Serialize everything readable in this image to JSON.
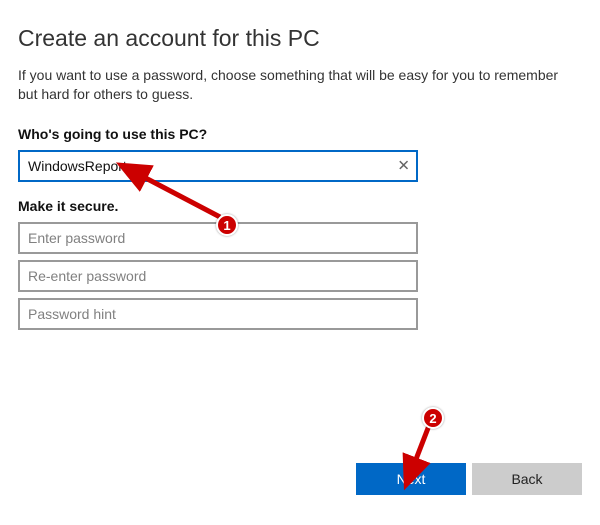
{
  "title": "Create an account for this PC",
  "subtitle": "If you want to use a password, choose something that will be easy for you to remember but hard for others to guess.",
  "username_section": {
    "label": "Who's going to use this PC?",
    "value": "WindowsReport",
    "clear_icon": "✕"
  },
  "password_section": {
    "label": "Make it secure.",
    "password_placeholder": "Enter password",
    "confirm_placeholder": "Re-enter password",
    "hint_placeholder": "Password hint"
  },
  "buttons": {
    "next_label": "Next",
    "back_label": "Back"
  },
  "annotations": {
    "callout1": "1",
    "callout2": "2"
  },
  "colors": {
    "accent": "#0068c6",
    "annotation_red": "#cc0000"
  }
}
